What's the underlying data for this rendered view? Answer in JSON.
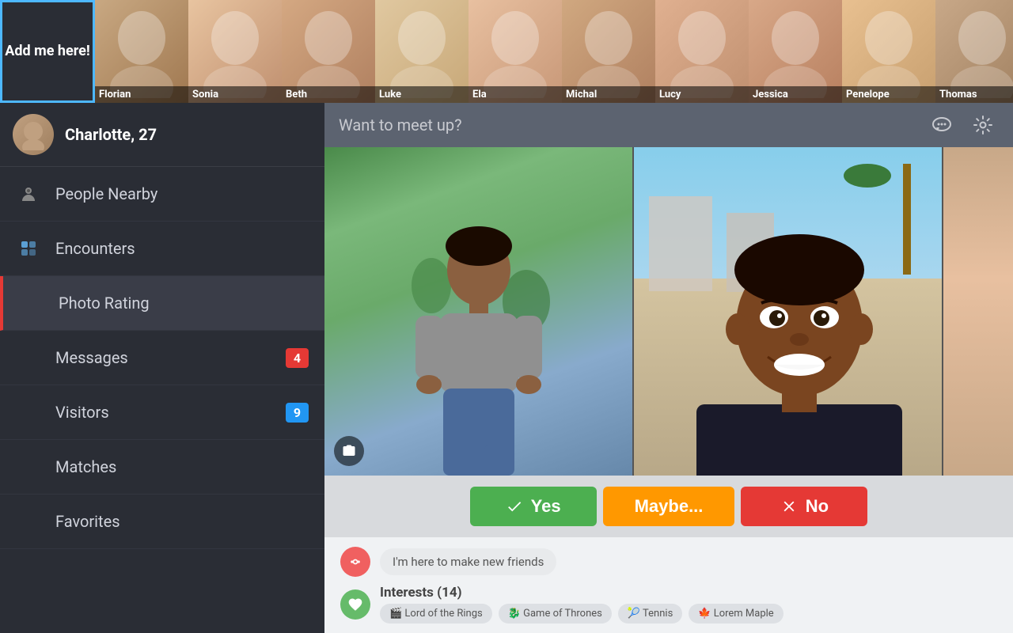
{
  "topBar": {
    "addMeLabel": "Add me here!",
    "profiles": [
      {
        "id": "florian",
        "name": "Florian",
        "colorClass": "face-florian"
      },
      {
        "id": "sonia",
        "name": "Sonia",
        "colorClass": "face-sonia"
      },
      {
        "id": "beth",
        "name": "Beth",
        "colorClass": "face-beth"
      },
      {
        "id": "luke",
        "name": "Luke",
        "colorClass": "face-luke"
      },
      {
        "id": "ela",
        "name": "Ela",
        "colorClass": "face-ela"
      },
      {
        "id": "michal",
        "name": "Michal",
        "colorClass": "face-michal"
      },
      {
        "id": "lucy",
        "name": "Lucy",
        "colorClass": "face-lucy"
      },
      {
        "id": "jessica",
        "name": "Jessica",
        "colorClass": "face-jessica"
      },
      {
        "id": "penelope",
        "name": "Penelope",
        "colorClass": "face-penelope"
      },
      {
        "id": "thomas",
        "name": "Thomas",
        "colorClass": "face-thomas"
      }
    ]
  },
  "sidebar": {
    "profileName": "Charlotte, 27",
    "navItems": [
      {
        "id": "people-nearby",
        "label": "People Nearby",
        "icon": "person-pin",
        "badge": null,
        "badgeType": null,
        "active": false
      },
      {
        "id": "encounters",
        "label": "Encounters",
        "icon": "encounters",
        "badge": null,
        "badgeType": null,
        "active": false
      },
      {
        "id": "photo-rating",
        "label": "Photo Rating",
        "icon": "star",
        "badge": null,
        "badgeType": null,
        "active": true
      },
      {
        "id": "messages",
        "label": "Messages",
        "icon": "chat",
        "badge": "4",
        "badgeType": "red",
        "active": false
      },
      {
        "id": "visitors",
        "label": "Visitors",
        "icon": "eye",
        "badge": "9",
        "badgeType": "blue",
        "active": false
      },
      {
        "id": "matches",
        "label": "Matches",
        "icon": "check-circle",
        "badge": null,
        "badgeType": null,
        "active": false
      },
      {
        "id": "favorites",
        "label": "Favorites",
        "icon": "star-outline",
        "badge": null,
        "badgeType": null,
        "active": false
      }
    ]
  },
  "rightPanel": {
    "headerTitle": "Want to meet up?",
    "chatIcon": "💬",
    "settingsIcon": "⚙",
    "buttons": {
      "yes": "Yes",
      "maybe": "Maybe...",
      "no": "No"
    },
    "statusMessage": "I'm here to make new friends",
    "interestsLabel": "Interests (14)",
    "interestTags": [
      {
        "icon": "🎬",
        "label": "Lord of the Rings"
      },
      {
        "icon": "🐉",
        "label": "Game of Thrones"
      },
      {
        "icon": "🎾",
        "label": "Tennis"
      },
      {
        "icon": "🍁",
        "label": "Lorem Maple"
      }
    ]
  }
}
